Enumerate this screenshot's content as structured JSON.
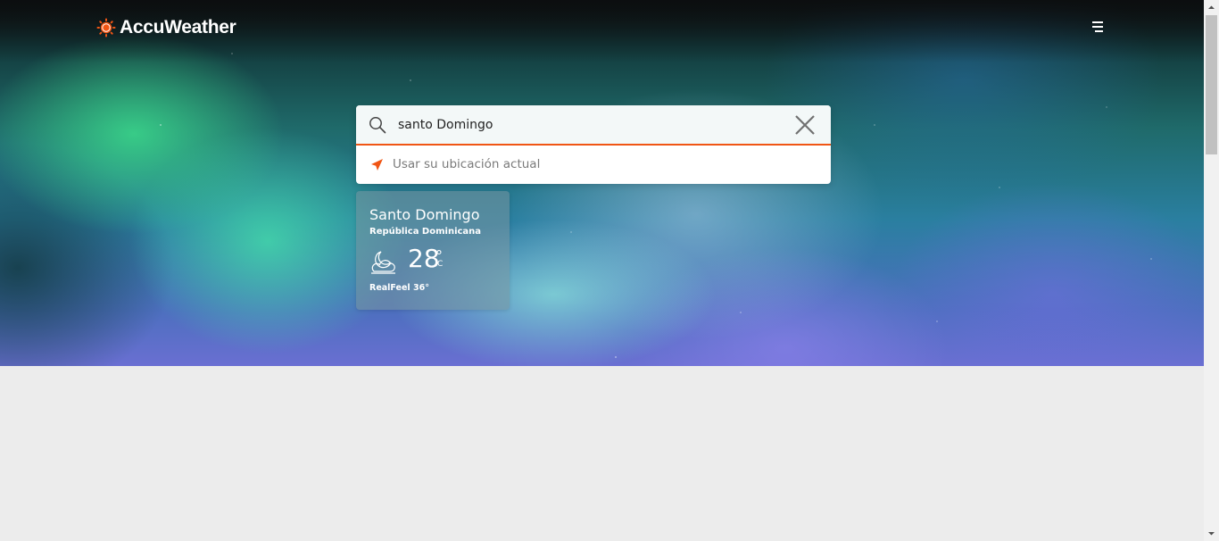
{
  "header": {
    "brand": "AccuWeather",
    "menu_icon": "hamburger-menu-icon"
  },
  "search": {
    "value": "santo Domingo",
    "search_icon": "search-icon",
    "clear_icon": "close-icon",
    "use_location_label": "Usar su ubicación actual",
    "location_icon": "location-arrow-icon"
  },
  "card": {
    "city": "Santo Domingo",
    "country": "República Dominicana",
    "temperature": "28",
    "degree_symbol": "°",
    "unit": "C",
    "realfeel": "RealFeel 36°",
    "condition_icon": "partly-cloudy-night-icon"
  },
  "colors": {
    "brand_orange": "#f05514",
    "content_background": "#ececec"
  }
}
